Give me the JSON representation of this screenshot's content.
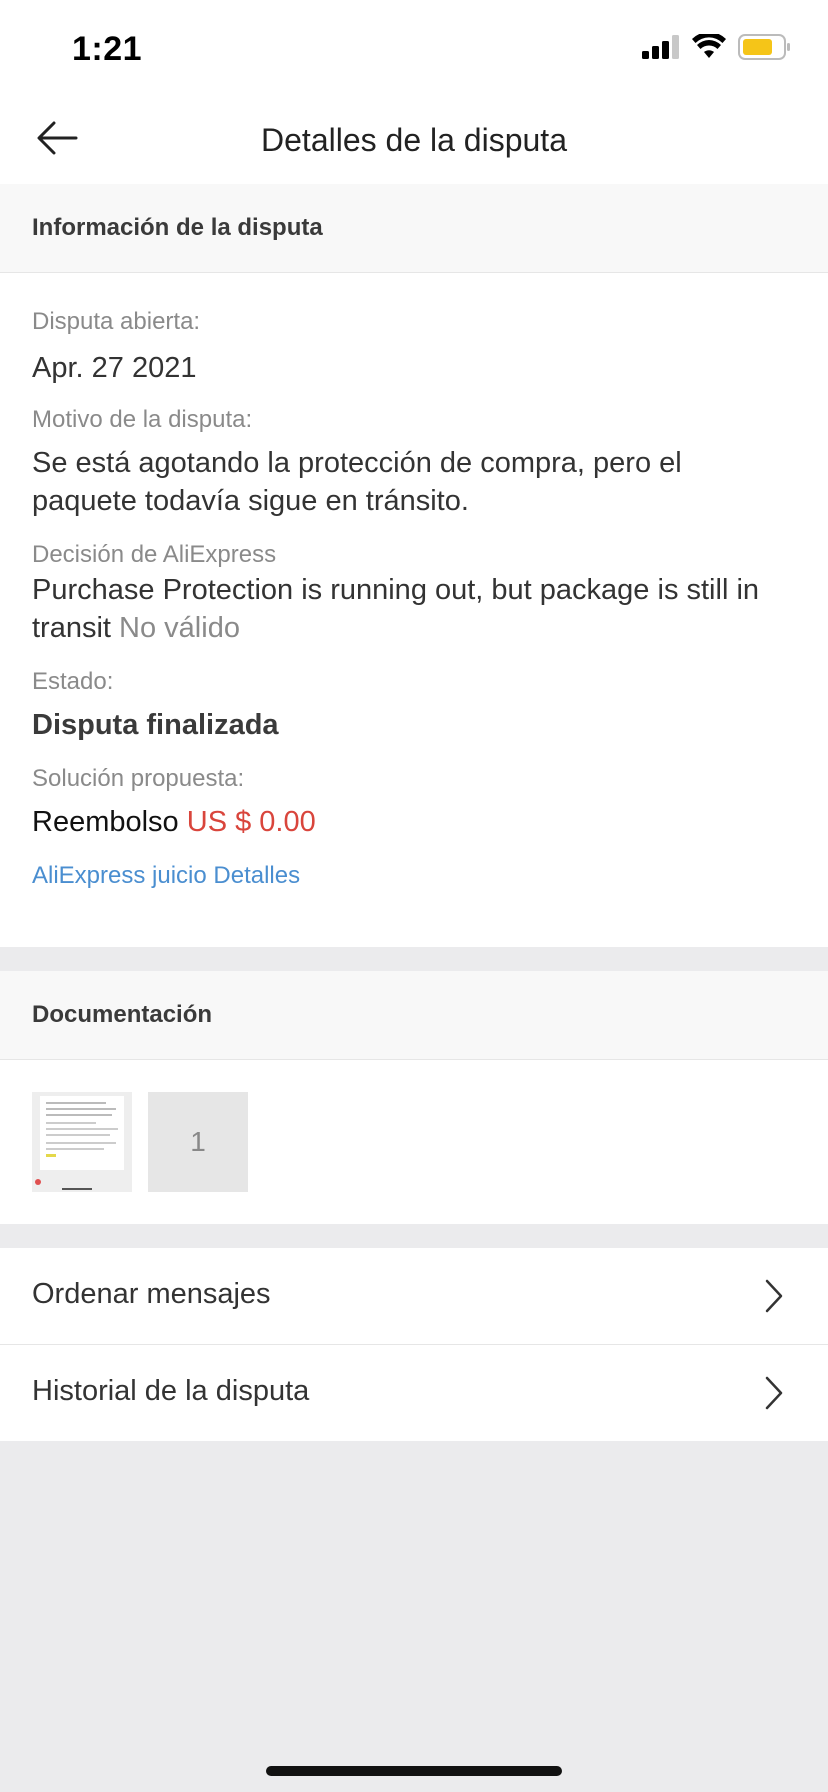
{
  "status_bar": {
    "time": "1:21"
  },
  "nav": {
    "title": "Detalles de la disputa",
    "back_icon": "arrow-left-icon"
  },
  "dispute_info": {
    "header": "Información de la disputa",
    "opened_label": "Disputa abierta:",
    "opened_value": "Apr. 27 2021",
    "reason_label": "Motivo de la disputa:",
    "reason_value": "Se está agotando la protección de compra, pero el paquete todavía sigue en tránsito.",
    "decision_label": "Decisión de AliExpress",
    "decision_value": "Purchase Protection is running out, but package is still in transit",
    "decision_status": "No válido",
    "state_label": "Estado:",
    "state_value": "Disputa finalizada",
    "solution_label": "Solución propuesta:",
    "solution_prefix": "Reembolso",
    "solution_amount": "US $ 0.00",
    "judgment_link": "AliExpress juicio Detalles"
  },
  "documentation": {
    "header": "Documentación",
    "count_tile": "1"
  },
  "menu_rows": [
    {
      "label": "Ordenar mensajes"
    },
    {
      "label": "Historial de la disputa"
    }
  ],
  "colors": {
    "accent_red": "#d9453c",
    "link_blue": "#4a8ed0",
    "battery_yellow": "#f5c518"
  }
}
